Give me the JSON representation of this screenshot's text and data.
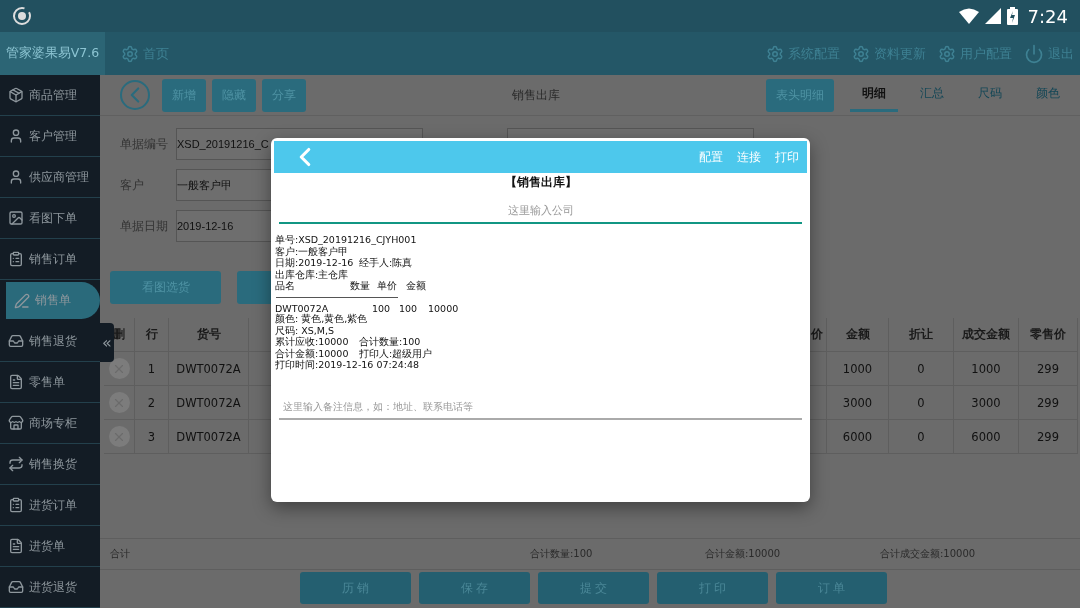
{
  "status_bar": {
    "time": "7:24"
  },
  "header": {
    "app_title": "管家婆果易V7.6",
    "home": "首页",
    "actions": [
      {
        "label": "系统配置",
        "kind": "gear"
      },
      {
        "label": "资料更新",
        "kind": "gear"
      },
      {
        "label": "用户配置",
        "kind": "gear"
      },
      {
        "label": "退出",
        "kind": "power"
      }
    ]
  },
  "sidebar": {
    "items": [
      {
        "label": "商品管理",
        "selected": false
      },
      {
        "label": "客户管理",
        "selected": false
      },
      {
        "label": "供应商管理",
        "selected": false
      },
      {
        "label": "看图下单",
        "selected": false
      },
      {
        "label": "销售订单",
        "selected": false
      },
      {
        "label": "销售单",
        "selected": true
      },
      {
        "label": "销售退货",
        "selected": false
      },
      {
        "label": "零售单",
        "selected": false
      },
      {
        "label": "商场专柜",
        "selected": false
      },
      {
        "label": "销售换货",
        "selected": false
      },
      {
        "label": "进货订单",
        "selected": false
      },
      {
        "label": "进货单",
        "selected": false
      },
      {
        "label": "进货退货",
        "selected": false
      }
    ],
    "collapse": "«"
  },
  "toolbar": {
    "buttons": [
      "新增",
      "隐藏",
      "分享"
    ],
    "title": "销售出库",
    "header_button": "表头明细",
    "tabs": [
      {
        "label": "明细",
        "selected": true
      },
      {
        "label": "汇总",
        "selected": false
      },
      {
        "label": "尺码",
        "selected": false
      },
      {
        "label": "颜色",
        "selected": false
      }
    ]
  },
  "form": {
    "fields": [
      {
        "label": "单据编号",
        "value": "XSD_20191216_C"
      },
      {
        "label": "客户",
        "value": "一般客户甲"
      },
      {
        "label": "单据日期",
        "value": "2019-12-16"
      }
    ]
  },
  "pick_button": "看图选货",
  "table": {
    "columns": [
      "删",
      "行",
      "货号",
      "价",
      "金额",
      "折让",
      "成交金额",
      "零售价"
    ],
    "rows": [
      {
        "row": "1",
        "code": "DWT0072A",
        "amount": "1000",
        "discount": "0",
        "deal_amount": "1000",
        "retail_price": "299"
      },
      {
        "row": "2",
        "code": "DWT0072A",
        "amount": "3000",
        "discount": "0",
        "deal_amount": "3000",
        "retail_price": "299"
      },
      {
        "row": "3",
        "code": "DWT0072A",
        "amount": "6000",
        "discount": "0",
        "deal_amount": "6000",
        "retail_price": "299"
      }
    ]
  },
  "totals": {
    "label": "合计",
    "quantity": "合计数量:100",
    "amount": "合计金额:10000",
    "deal_amount": "合计成交金额:10000"
  },
  "bottom_buttons": [
    "历 销",
    "保 存",
    "提 交",
    "打 印",
    "订 单"
  ],
  "dialog": {
    "actions": [
      "配置",
      "连接",
      "打印"
    ],
    "title": "【销售出库】",
    "company_placeholder": "这里输入公司",
    "receipt": [
      {
        "kind": "text",
        "parts": [
          "单号:XSD_20191216_CJYH001"
        ]
      },
      {
        "kind": "text",
        "parts": [
          "客户:一般客户甲"
        ]
      },
      {
        "kind": "pair",
        "parts": [
          "日期:2019-12-16",
          "经手人:陈真"
        ]
      },
      {
        "kind": "text",
        "parts": [
          "出库仓库:主仓库"
        ]
      },
      {
        "kind": "header",
        "parts": [
          "品名",
          "数量",
          "单价",
          "金额"
        ]
      },
      {
        "kind": "divider"
      },
      {
        "kind": "item",
        "parts": [
          "DWT0072A",
          "100",
          "100",
          "10000"
        ]
      },
      {
        "kind": "text",
        "parts": [
          "颜色: 黄色,黄色,紫色"
        ]
      },
      {
        "kind": "text",
        "parts": [
          "尺码: XS,M,S"
        ]
      },
      {
        "kind": "pair",
        "parts": [
          "累计应收:10000",
          "合计数量:100"
        ]
      },
      {
        "kind": "pair",
        "parts": [
          "合计金额:10000",
          "打印人:超级用户"
        ]
      },
      {
        "kind": "text",
        "parts": [
          "打印时间:2019-12-16 07:24:48"
        ]
      }
    ],
    "remark_placeholder": "这里输入备注信息，如：地址、联系电话等"
  }
}
